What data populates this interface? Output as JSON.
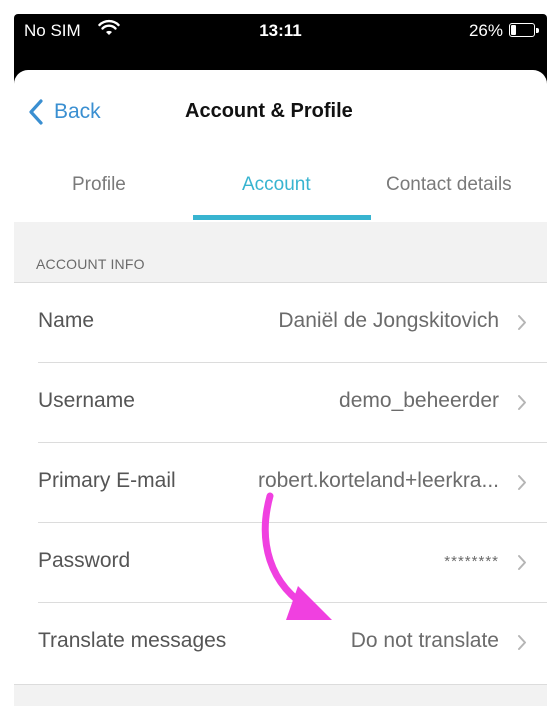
{
  "status_bar": {
    "carrier": "No SIM",
    "time": "13:11",
    "battery_text": "26%",
    "battery_level": 0.26
  },
  "nav": {
    "back_label": "Back",
    "title": "Account & Profile"
  },
  "tabs": [
    {
      "label": "Profile",
      "active": false
    },
    {
      "label": "Account",
      "active": true
    },
    {
      "label": "Contact details",
      "active": false
    }
  ],
  "section": {
    "header": "ACCOUNT INFO"
  },
  "rows": [
    {
      "label": "Name",
      "value": "Daniël de Jongskitovich"
    },
    {
      "label": "Username",
      "value": "demo_beheerder"
    },
    {
      "label": "Primary E-mail",
      "value": "robert.korteland+leerkra..."
    },
    {
      "label": "Password",
      "value": "********"
    },
    {
      "label": "Translate messages",
      "value": "Do not translate"
    }
  ],
  "colors": {
    "accent": "#38b4d0",
    "back_blue": "#3a8fd1",
    "annotation_arrow": "#f040e0"
  },
  "icons": {
    "back": "chevron-left-icon",
    "row": "chevron-right-icon",
    "wifi": "wifi-icon",
    "battery": "battery-icon",
    "annotation": "arrow-annotation"
  }
}
